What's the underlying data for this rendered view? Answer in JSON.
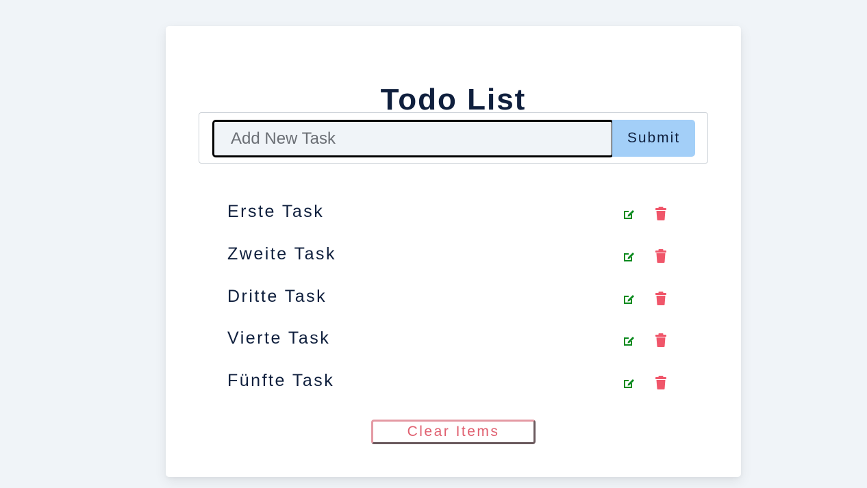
{
  "app": {
    "title": "Todo List"
  },
  "form": {
    "input_value": "",
    "input_placeholder": "Add New Task",
    "submit_label": "Submit"
  },
  "tasks": [
    {
      "name": "Erste Task"
    },
    {
      "name": "Zweite Task"
    },
    {
      "name": "Dritte Task"
    },
    {
      "name": "Vierte Task"
    },
    {
      "name": "Fünfte Task"
    }
  ],
  "actions": {
    "clear_label": "Clear Items"
  },
  "icons": {
    "edit": "edit-icon",
    "delete": "trash-icon"
  },
  "colors": {
    "page_background": "#f0f4f8",
    "card_background": "#ffffff",
    "title_text": "#0f1f3d",
    "submit_background": "#a3cff8",
    "edit_icon": "#0b8a1e",
    "delete_icon": "#f0566a",
    "clear_text": "#e06070"
  }
}
